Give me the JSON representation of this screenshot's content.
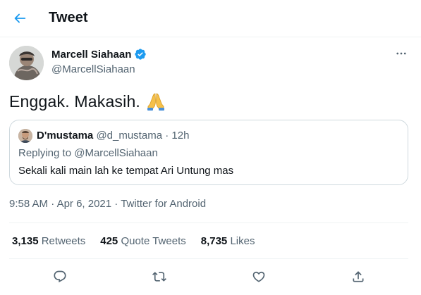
{
  "header": {
    "title": "Tweet",
    "back_icon": "arrow-left-icon"
  },
  "tweet": {
    "author": {
      "name": "Marcell Siahaan",
      "handle": "@MarcellSiahaan",
      "verified": true
    },
    "text": "Enggak. Makasih.",
    "emoji": "folded-hands-emoji",
    "quote": {
      "name": "D'mustama",
      "handle": "@d_mustama",
      "separator": " · ",
      "time": "12h",
      "replying_to_label": "Replying to ",
      "replying_to_handle": "@MarcellSiahaan",
      "text": "Sekali kali main lah ke tempat Ari Untung mas"
    },
    "timestamp": {
      "time": "9:58 AM",
      "separator": " · ",
      "date": "Apr 6, 2021",
      "source": "Twitter for Android"
    }
  },
  "stats": [
    {
      "count": "3,135",
      "label": "Retweets"
    },
    {
      "count": "425",
      "label": "Quote Tweets"
    },
    {
      "count": "8,735",
      "label": "Likes"
    }
  ],
  "actions": [
    "reply-icon",
    "retweet-icon",
    "like-icon",
    "share-icon"
  ],
  "colors": {
    "accent": "#1d9bf0",
    "secondary_text": "#536471",
    "border": "#cfd9de"
  }
}
